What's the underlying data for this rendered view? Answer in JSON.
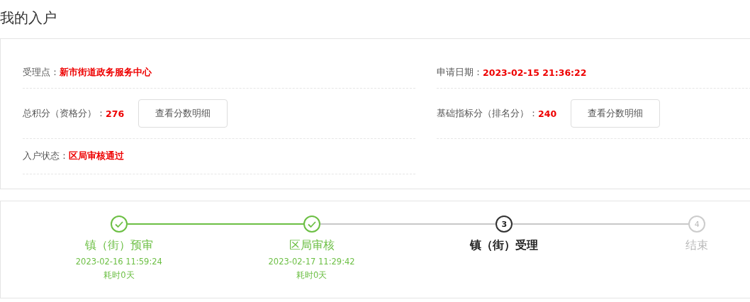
{
  "page_title": "我的入户",
  "info": {
    "rows": [
      {
        "left": {
          "label": "受理点：",
          "value": "新市街道政务服务中心"
        },
        "right": {
          "label": "申请日期：",
          "value": "2023-02-15 21:36:22"
        }
      },
      {
        "left": {
          "label": "总积分（资格分）：",
          "value": "276",
          "button": "查看分数明细"
        },
        "right": {
          "label": "基础指标分（排名分）：",
          "value": "240",
          "button": "查看分数明细"
        }
      },
      {
        "left": {
          "label": "入户状态：",
          "value": "区局审核通过"
        }
      }
    ]
  },
  "steps": [
    {
      "title": "镇（街）预审",
      "done": true,
      "current": false,
      "time": "2023-02-16 11:59:24",
      "duration": "耗时0天"
    },
    {
      "title": "区局审核",
      "done": true,
      "current": false,
      "time": "2023-02-17 11:29:42",
      "duration": "耗时0天"
    },
    {
      "marker": "3",
      "title": "镇（街）受理",
      "done": false,
      "current": true
    },
    {
      "marker": "4",
      "title": "结束",
      "done": false,
      "current": false
    }
  ]
}
